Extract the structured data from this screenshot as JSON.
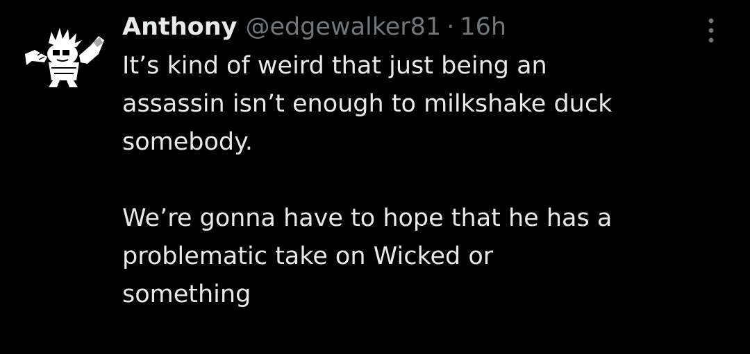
{
  "tweet": {
    "author": {
      "display_name": "Anthony",
      "handle": "@edgewalker81",
      "avatar_icon": "cartoon-character-avatar-icon"
    },
    "separator": "·",
    "timestamp": "16h",
    "text_lines_paragraph_1": [
      "It’s kind of weird that just being an",
      "assassin isn’t enough to milkshake duck",
      "somebody."
    ],
    "text_lines_paragraph_2": [
      "We’re gonna have to hope that he has a",
      "problematic take on Wicked or",
      "something"
    ],
    "more_icon": "more-vertical-icon"
  },
  "colors": {
    "background": "#000000",
    "primary_text": "#e7e9ea",
    "secondary_text": "#71767b"
  }
}
